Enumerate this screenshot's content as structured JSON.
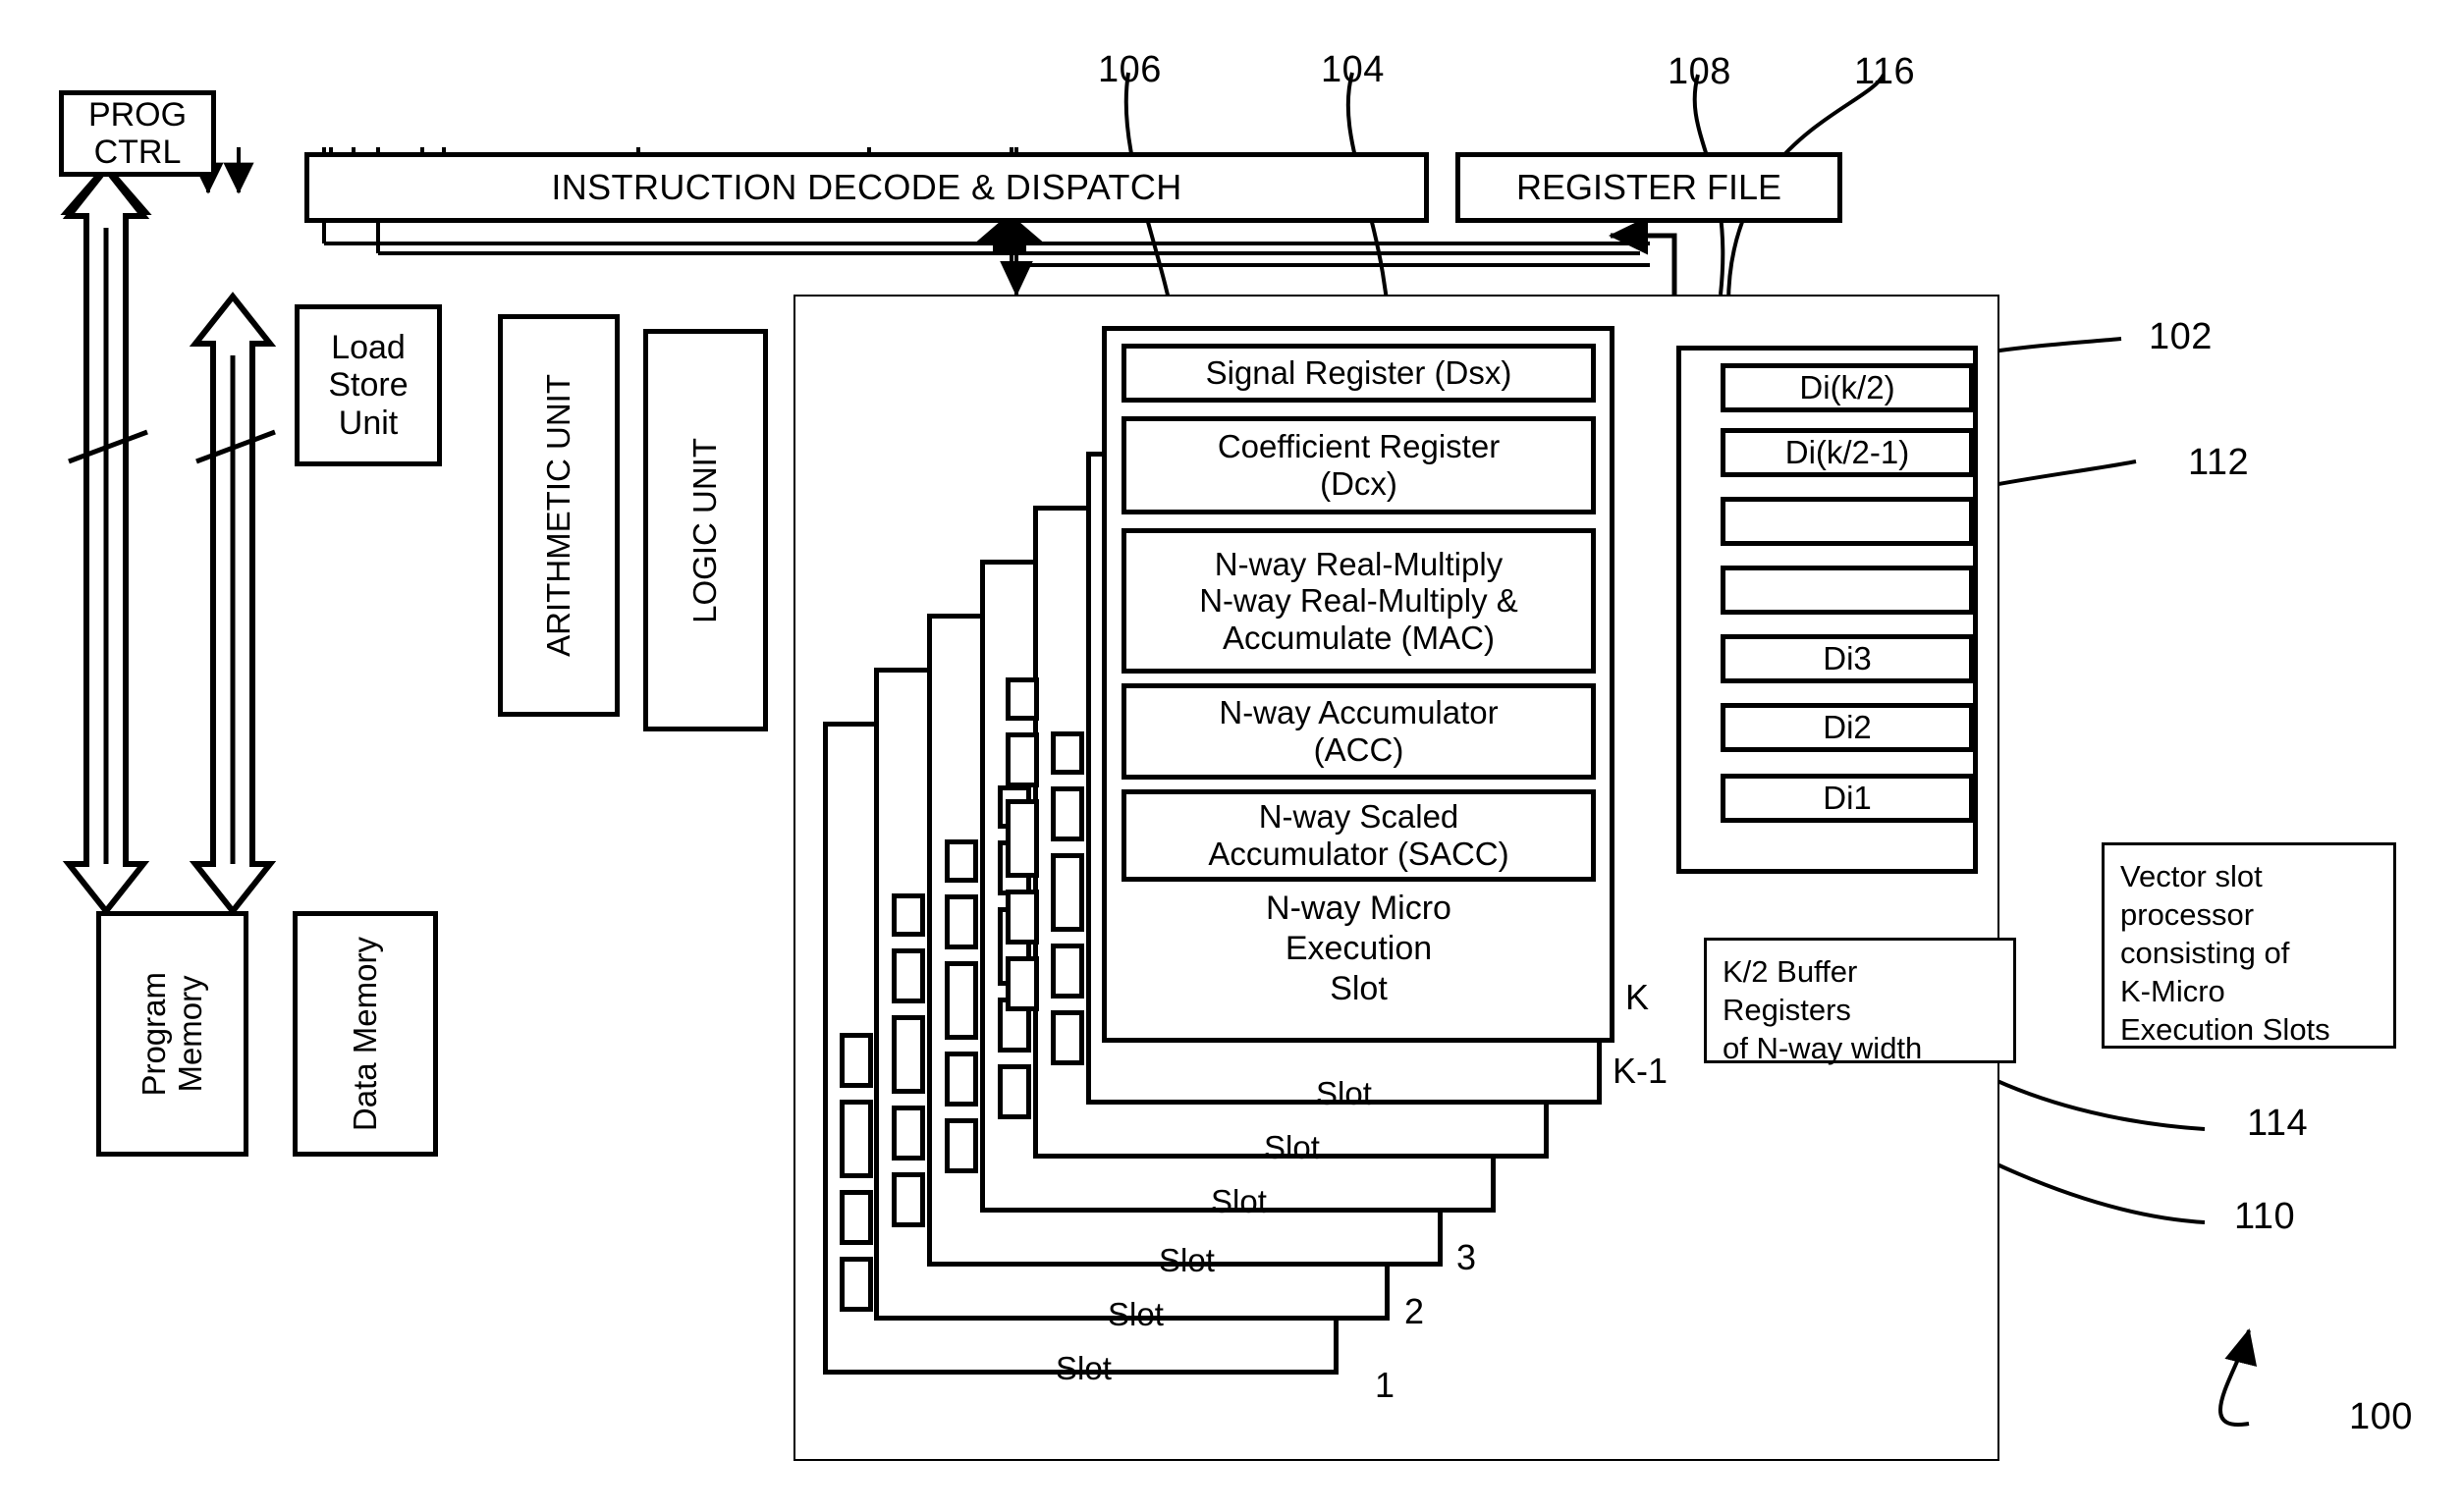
{
  "figure": {
    "title": "Vector slot processor block diagram",
    "top_blocks": {
      "prog_ctrl": "PROG\nCTRL",
      "prog_ctrl_line1": "PROG",
      "prog_ctrl_line2": "CTRL",
      "instruction_decode": "INSTRUCTION DECODE & DISPATCH",
      "register_file": "REGISTER FILE"
    },
    "units": {
      "load_store_line1": "Load",
      "load_store_line2": "Store",
      "load_store_line3": "Unit",
      "arithmetic_unit": "ARITHMETIC UNIT",
      "logic_unit": "LOGIC UNIT"
    },
    "memories": {
      "program_memory_line1": "Program",
      "program_memory_line2": "Memory",
      "data_memory": "Data Memory"
    },
    "slot": {
      "signal_register": "Signal Register (Dsx)",
      "coefficient_register_line1": "Coefficient Register",
      "coefficient_register_line2": "(Dcx)",
      "mac_line1": "N-way Real-Multiply",
      "mac_line2": "N-way Real-Multiply &",
      "mac_line3": "Accumulate (MAC)",
      "acc_line1": "N-way Accumulator",
      "acc_line2": "(ACC)",
      "sacc_line1": "N-way Scaled",
      "sacc_line2": "Accumulator (SACC)",
      "title_line1": "N-way Micro",
      "title_line2": "Execution",
      "title_line3": "Slot",
      "stack_word": "Slot",
      "stack_indices": [
        "K",
        "K-1",
        "3",
        "2",
        "1"
      ]
    },
    "di_registers": [
      "Di(k/2)",
      "Di(k/2-1)",
      "",
      "",
      "Di3",
      "Di2",
      "Di1"
    ],
    "notes": {
      "buffer_line1": "K/2 Buffer",
      "buffer_line2": "Registers",
      "buffer_line3": "of N-way width",
      "vector_line1": "Vector slot",
      "vector_line2": "processor",
      "vector_line3": "consisting of",
      "vector_line4": "K-Micro",
      "vector_line5": "Execution Slots"
    },
    "reference_numerals": {
      "n100": "100",
      "n102": "102",
      "n104": "104",
      "n106": "106",
      "n108": "108",
      "n110": "110",
      "n112": "112",
      "n114": "114",
      "n116": "116"
    },
    "colors": {
      "line": "#000000",
      "background": "#ffffff"
    }
  }
}
